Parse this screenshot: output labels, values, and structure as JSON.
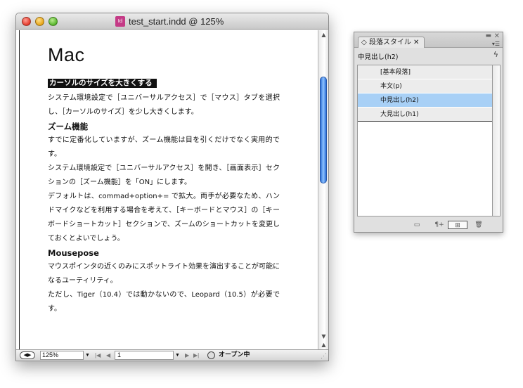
{
  "document": {
    "title": "test_start.indd @ 125%",
    "icon_label": "Id",
    "heading": "Mac",
    "sections": [
      {
        "type": "highlight",
        "text": "カーソルのサイズを大きくする"
      },
      {
        "type": "body",
        "text": "システム環境設定で［ユニバーサルアクセス］で［マウス］タブを選択し、［カーソルのサイズ］を少し大きくします。"
      },
      {
        "type": "h2",
        "text": "ズーム機能"
      },
      {
        "type": "body",
        "text": "すでに定番化していますが、ズーム機能は目を引くだけでなく実用的です。"
      },
      {
        "type": "body",
        "text": "システム環境設定で［ユニバーサルアクセス］を開き、［画面表示］セクションの［ズーム機能］を「ON」にします。"
      },
      {
        "type": "body",
        "text": "デフォルトは、commad+option+= で拡大。両手が必要なため、ハンドマイクなどを利用する場合を考えて、［キーボードとマウス］の［キーボードショートカット］セクションで、ズームのショートカットを変更しておくとよいでしょう。"
      },
      {
        "type": "h2",
        "text": "Mousepose"
      },
      {
        "type": "body",
        "text": "マウスポインタの近くのみにスポットライト効果を演出することが可能になるユーティリティ。"
      },
      {
        "type": "body",
        "text": "ただし、Tiger（10.4）では動かないので、Leopard（10.5）が必要です。"
      }
    ]
  },
  "statusbar": {
    "zoom": "125%",
    "page": "1",
    "status": "オープン中"
  },
  "panel": {
    "tab_label": "段落スタイル",
    "current_style": "中見出し(h2)",
    "styles": [
      "[基本段落]",
      "本文(p)",
      "中見出し(h2)",
      "大見出し(h1)"
    ],
    "selected_index": 2
  }
}
